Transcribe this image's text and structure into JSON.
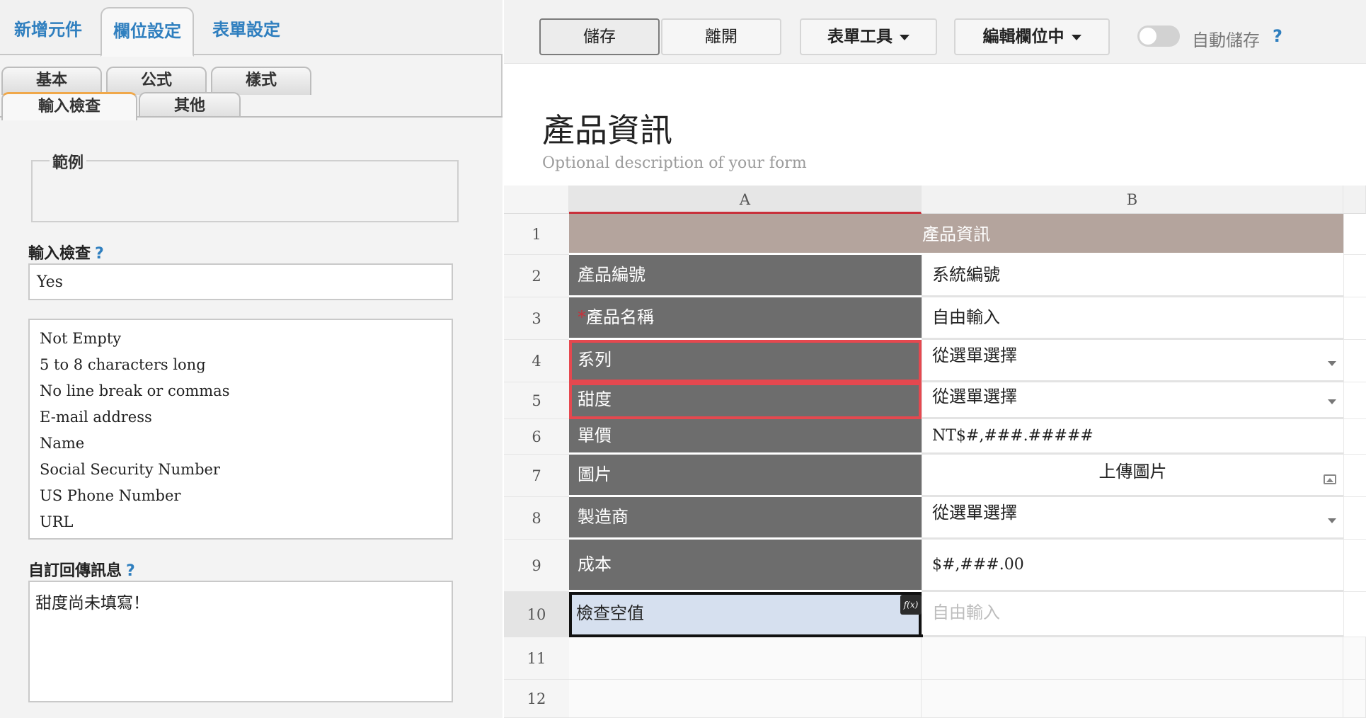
{
  "left": {
    "top_tabs": [
      "新增元件",
      "欄位設定",
      "表單設定"
    ],
    "sub_tabs": [
      "基本",
      "公式",
      "樣式",
      "輸入檢查",
      "其他"
    ],
    "example_label": "範例",
    "validation_label": "輸入檢查",
    "validation_value": "Yes",
    "help_mark": "?",
    "rules": [
      "Not Empty",
      "5 to 8 characters long",
      "No line break or commas",
      "E-mail address",
      "Name",
      "Social Security Number",
      "US Phone Number",
      "URL"
    ],
    "message_label": "自訂回傳訊息",
    "message_value": "甜度尚未填寫！"
  },
  "toolbar": {
    "save": "儲存",
    "leave": "離開",
    "tools": "表單工具",
    "edit": "編輯欄位中",
    "autosave": "自動儲存",
    "help": "?"
  },
  "form": {
    "title": "產品資訊",
    "description": "Optional description of your form"
  },
  "grid": {
    "columns": [
      "A",
      "B"
    ],
    "row_numbers": [
      "1",
      "2",
      "3",
      "4",
      "5",
      "6",
      "7",
      "8",
      "9",
      "10",
      "11",
      "12"
    ],
    "header_row": "產品資訊",
    "rows": [
      {
        "a": "產品編號",
        "b": "系統編號"
      },
      {
        "a": "產品名稱",
        "b": "自由輸入",
        "required_mark": "*"
      },
      {
        "a": "系列",
        "b": "從選單選擇"
      },
      {
        "a": "甜度",
        "b": "從選單選擇"
      },
      {
        "a": "單價",
        "b": "NT$#,###.#####"
      },
      {
        "a": "圖片",
        "b": "上傳圖片"
      },
      {
        "a": "製造商",
        "b": "從選單選擇"
      },
      {
        "a": "成本",
        "b": "$#,###.00"
      },
      {
        "a": "檢查空值",
        "b": "自由輸入"
      }
    ],
    "fx_badge": "f(x)"
  },
  "colors": {
    "accent": "#2f7fbf",
    "label_cell": "#6d6d6d",
    "header_cell": "#b4a49d",
    "highlight": "#e5484f",
    "selected_cell": "#d6e0ef"
  }
}
